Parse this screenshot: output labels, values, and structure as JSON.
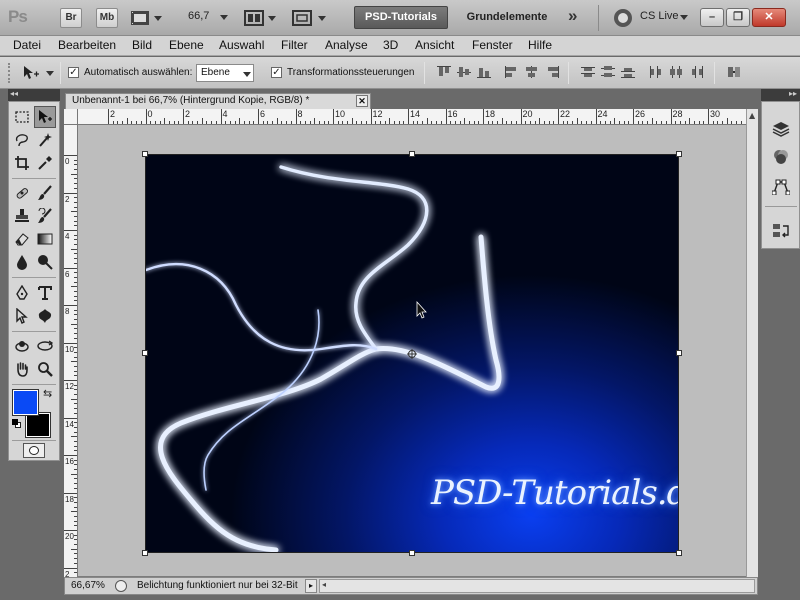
{
  "app": {
    "logo": "Ps",
    "bridge_btn": "Br",
    "minibridge_btn": "Mb",
    "zoom_value": "66,7",
    "workspace_active": "PSD-Tutorials",
    "workspace_other": "Grundelemente",
    "more_workspaces": "»",
    "cslive_label": "CS Live"
  },
  "menu": {
    "items": [
      "Datei",
      "Bearbeiten",
      "Bild",
      "Ebene",
      "Auswahl",
      "Filter",
      "Analyse",
      "3D",
      "Ansicht",
      "Fenster",
      "Hilfe"
    ]
  },
  "options": {
    "auto_select_label": "Automatisch auswählen:",
    "auto_select_value": "Ebene",
    "transform_label": "Transformationssteuerungen"
  },
  "document": {
    "tab_title": "Unbenannt-1 bei 66,7% (Hintergrund Kopie, RGB/8) *",
    "close_glyph": "✕",
    "watermark": "PSD-Tutorials.de"
  },
  "rulers": {
    "h_ticks": [
      "2",
      "0",
      "2",
      "4",
      "6",
      "8",
      "10",
      "12",
      "14",
      "16",
      "18",
      "20",
      "22",
      "24",
      "26",
      "28",
      "30"
    ],
    "v_ticks": [
      "0",
      "2",
      "4",
      "6",
      "8",
      "10",
      "12",
      "14",
      "16",
      "18",
      "20",
      "2"
    ]
  },
  "status": {
    "zoom": "66,67%",
    "message": "Belichtung funktioniert nur bei 32-Bit"
  },
  "colors": {
    "foreground": "#0a4af5",
    "background": "#000000",
    "accent_blue": "#0a3ff0"
  }
}
